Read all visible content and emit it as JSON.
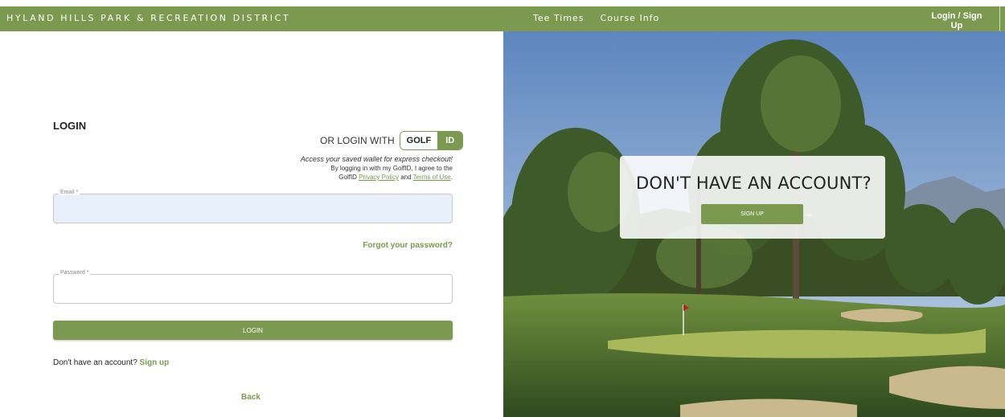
{
  "header": {
    "brand": "HYLAND HILLS PARK & RECREATION DISTRICT",
    "nav": [
      "Tee Times",
      "Course Info"
    ],
    "login_label": "Login / Sign Up"
  },
  "login": {
    "heading": "LOGIN",
    "or_login_with": "OR LOGIN WITH",
    "golfid_left": "GOLF",
    "golfid_right": "ID",
    "access_text": "Access your saved wallet for express checkout!",
    "agree_line1": "By logging in with my GolfID, I agree to the",
    "agree_prefix": "GolfID",
    "privacy_link": "Privacy Policy",
    "and_text": "and",
    "terms_link": "Terms of Use",
    "email_label": "Email *",
    "password_label": "Password *",
    "forgot_label": "Forgot your password?",
    "login_button": "LOGIN",
    "no_account_text": "Don't have an account?",
    "signup_link": "Sign up",
    "back_label": "Back"
  },
  "promo": {
    "question": "DON'T HAVE AN ACCOUNT?",
    "signup_button": "SIGN UP"
  },
  "colors": {
    "accent": "#7c9a4f"
  }
}
